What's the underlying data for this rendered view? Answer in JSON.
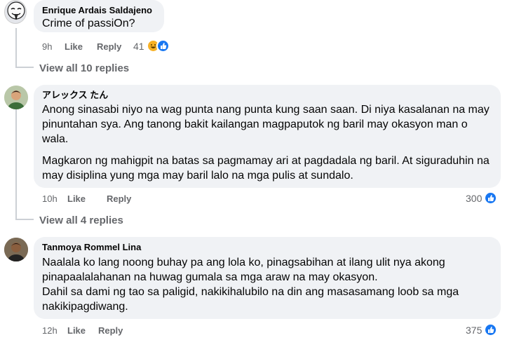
{
  "comments": [
    {
      "author": "Enrique Ardais Saldajeno",
      "paragraphs": [
        "Crime of passiOn?"
      ],
      "time": "9h",
      "like_label": "Like",
      "reply_label": "Reply",
      "reaction_count": "41",
      "reactions": [
        "haha-icon",
        "like-icon"
      ]
    },
    {
      "author": "アレックス たん",
      "paragraphs": [
        "Anong sinasabi niyo na wag punta nang punta kung saan saan. Di niya kasalanan na may pinuntahan sya. Ang tanong bakit kailangan magpaputok ng baril may okasyon man o wala.",
        "Magkaron ng mahigpit na batas sa pagmamay ari at pagdadala ng baril. At siguraduhin na may disiplina yung mga may baril lalo na mga pulis at sundalo."
      ],
      "time": "10h",
      "like_label": "Like",
      "reply_label": "Reply",
      "reaction_count": "300",
      "reactions": [
        "like-icon"
      ]
    },
    {
      "author": "Tanmoya Rommel Lina",
      "paragraphs": [
        "Naalala ko lang noong buhay pa ang lola ko, pinagsabihan at ilang ulit nya akong pinapaalalahanan na huwag gumala sa mga araw na may okasyon.\nDahil sa dami ng tao sa paligid, nakikihalubilo na din ang masasamang loob sa mga nakikipagdiwang."
      ],
      "time": "12h",
      "like_label": "Like",
      "reply_label": "Reply",
      "reaction_count": "375",
      "reactions": [
        "like-icon"
      ]
    }
  ],
  "view_replies": [
    "View all 10 replies",
    "View all 4 replies"
  ],
  "colors": {
    "bubble": "#f0f2f5",
    "secondary_text": "#65676b",
    "like_blue": "#1877f2",
    "haha_yellow": "#f7b125"
  }
}
